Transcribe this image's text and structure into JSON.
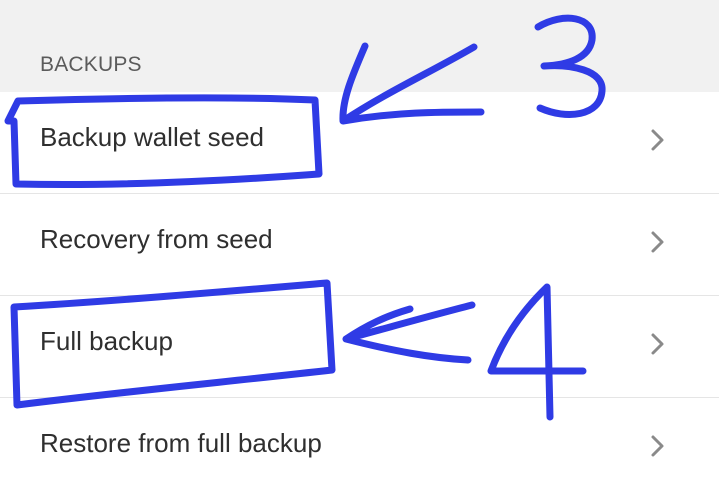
{
  "section": {
    "title": "BACKUPS"
  },
  "items": [
    {
      "label": "Backup wallet seed",
      "icon": "chevron-right-icon"
    },
    {
      "label": "Recovery from seed",
      "icon": "chevron-right-icon"
    },
    {
      "label": "Full backup",
      "icon": "chevron-right-icon"
    },
    {
      "label": "Restore from full backup",
      "icon": "chevron-right-icon"
    }
  ],
  "annotations": {
    "marks": [
      "3",
      "4"
    ],
    "color": "#2f3be5"
  },
  "colors": {
    "header_background": "#f1f1f1",
    "row_background": "#ffffff",
    "divider": "#e5e5e5",
    "text": "#2f2f2f",
    "chevron": "#8a8a8a"
  }
}
